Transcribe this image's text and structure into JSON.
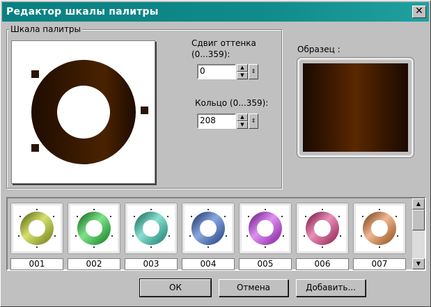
{
  "window": {
    "title": "Редактор шкалы палитры",
    "close_glyph": "✕"
  },
  "group": {
    "label": "Шкала палитры"
  },
  "hue_shift": {
    "label_line1": "Сдвиг оттенка",
    "label_line2": "(0...359):",
    "value": "0"
  },
  "ring": {
    "label": "Кольцо (0...359):",
    "value": "208"
  },
  "sample": {
    "label": "Образец :"
  },
  "preview": {
    "ring_color_dark": "#1e0c00",
    "ring_color_light": "#4a2200"
  },
  "palettes": [
    {
      "label": "001",
      "color_a": "#6b7a12",
      "color_b": "#d6e070",
      "color_c": "#4a5a08"
    },
    {
      "label": "002",
      "color_a": "#0d7a1e",
      "color_b": "#7ee38a",
      "color_c": "#0a5a14"
    },
    {
      "label": "003",
      "color_a": "#137a6a",
      "color_b": "#8ae0d0",
      "color_c": "#0a5a4a"
    },
    {
      "label": "004",
      "color_a": "#1d3e7a",
      "color_b": "#8aa8e0",
      "color_c": "#12285a"
    },
    {
      "label": "005",
      "color_a": "#7a1a9a",
      "color_b": "#e090f0",
      "color_c": "#5a0a7a"
    },
    {
      "label": "006",
      "color_a": "#8a1a4a",
      "color_b": "#e890b8",
      "color_c": "#6a0a32"
    },
    {
      "label": "007",
      "color_a": "#8a4a1a",
      "color_b": "#f0b890",
      "color_c": "#6a3210"
    }
  ],
  "buttons": {
    "ok": "ОК",
    "cancel": "Отмена",
    "add": "Добавить..."
  }
}
